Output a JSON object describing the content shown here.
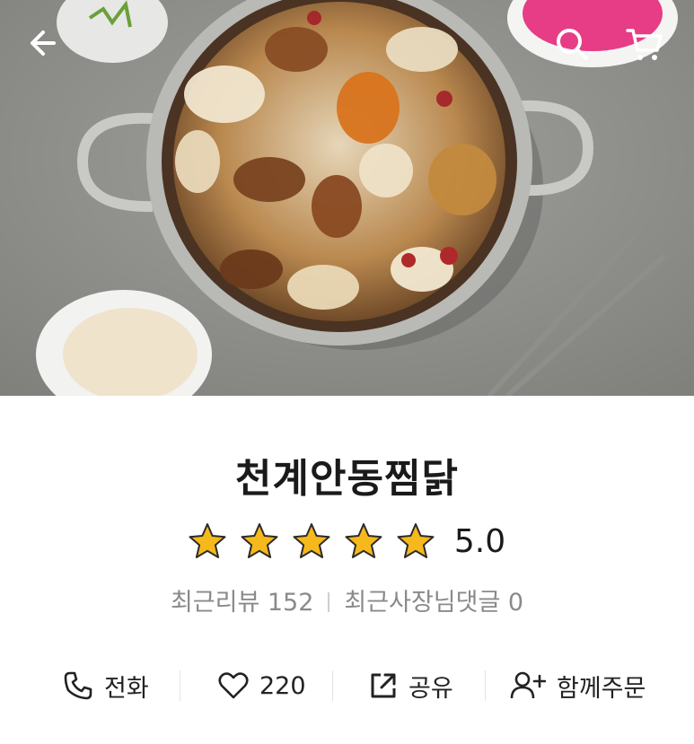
{
  "restaurant": {
    "name": "천계안동찜닭",
    "rating_value": 5.0,
    "rating_text": "5.0",
    "stars_filled": 5,
    "stars_total": 5,
    "star_color": "#f5b91b"
  },
  "meta": {
    "recent_reviews": "최근리뷰 152",
    "owner_comments": "최근사장님댓글 0"
  },
  "actions": {
    "call_label": "전화",
    "like_count": "220",
    "share_label": "공유",
    "group_order_label": "함께주문"
  },
  "icons": {
    "back": "arrow-left-icon",
    "search": "search-icon",
    "cart": "cart-icon",
    "call": "phone-icon",
    "like": "heart-icon",
    "share": "share-icon",
    "group_order": "add-user-icon",
    "rating": "star-icon"
  },
  "colors": {
    "title": "#1a1a1a",
    "meta_text": "#8a8a8a",
    "star_fill": "#f5b91b",
    "star_stroke": "#2b2b2b"
  }
}
